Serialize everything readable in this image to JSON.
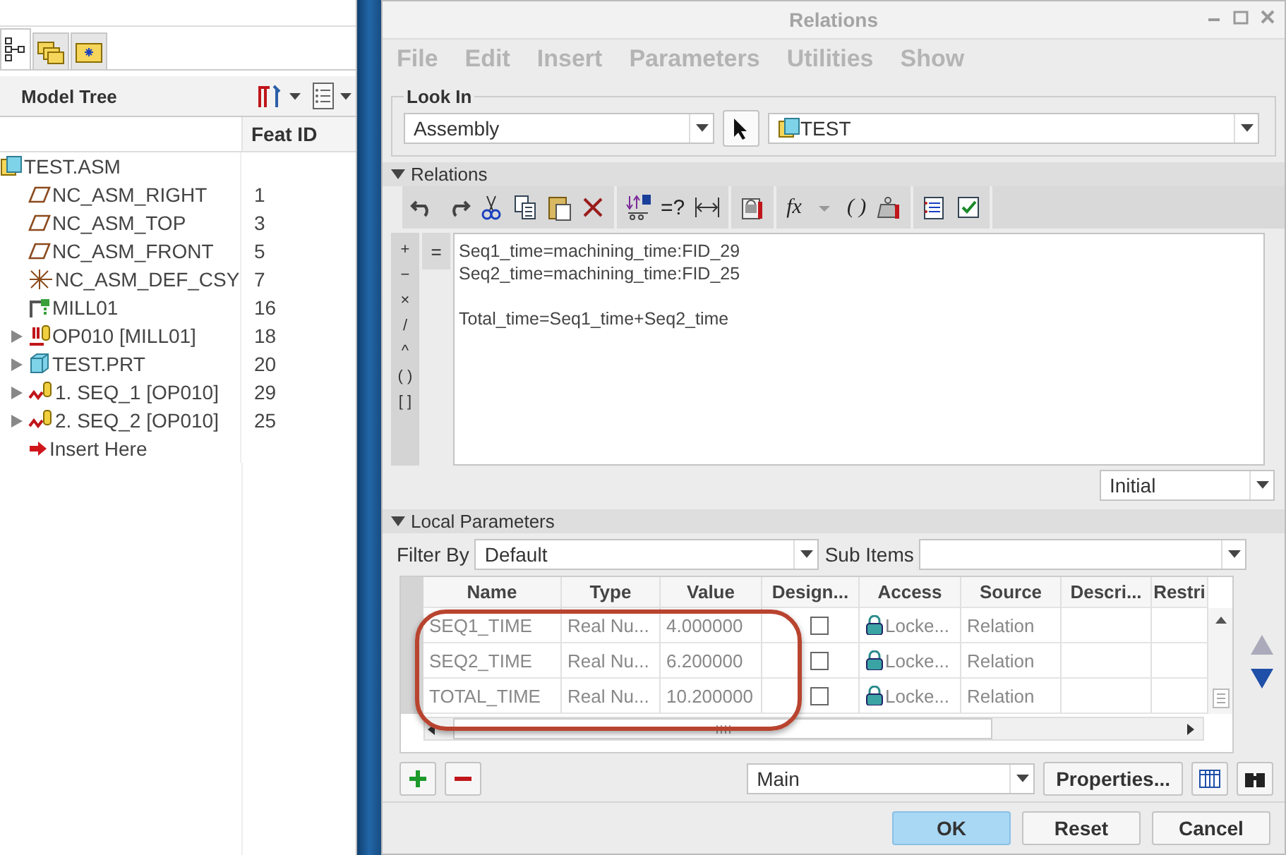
{
  "model_tree": {
    "tabs": [
      {
        "selected": true
      },
      {
        "selected": false
      },
      {
        "selected": false
      }
    ],
    "title": "Model Tree",
    "column": "Feat ID",
    "items": [
      {
        "label": "TEST.ASM",
        "kind": "assembly",
        "expandable": false,
        "children": [
          {
            "label": "NC_ASM_RIGHT",
            "feat_id": "1",
            "kind": "datum-plane",
            "expandable": false
          },
          {
            "label": "NC_ASM_TOP",
            "feat_id": "3",
            "kind": "datum-plane",
            "expandable": false
          },
          {
            "label": "NC_ASM_FRONT",
            "feat_id": "5",
            "kind": "datum-plane",
            "expandable": false
          },
          {
            "label": "NC_ASM_DEF_CSY",
            "feat_id": "7",
            "kind": "csys",
            "expandable": false
          },
          {
            "label": "MILL01",
            "feat_id": "16",
            "kind": "workcell",
            "expandable": false
          },
          {
            "label": "OP010 [MILL01]",
            "feat_id": "18",
            "kind": "operation",
            "expandable": true
          },
          {
            "label": "TEST.PRT",
            "feat_id": "20",
            "kind": "part",
            "expandable": true
          },
          {
            "label": "1. SEQ_1 [OP010]",
            "feat_id": "29",
            "kind": "sequence",
            "expandable": true
          },
          {
            "label": "2. SEQ_2 [OP010]",
            "feat_id": "25",
            "kind": "sequence",
            "expandable": true
          },
          {
            "label": "Insert Here",
            "kind": "insert",
            "expandable": false
          }
        ]
      }
    ]
  },
  "window": {
    "title": "Relations"
  },
  "menu": [
    {
      "label": "File",
      "disabled": true
    },
    {
      "label": "Edit",
      "disabled": true
    },
    {
      "label": "Insert",
      "disabled": true
    },
    {
      "label": "Parameters",
      "disabled": true
    },
    {
      "label": "Utilities",
      "disabled": true
    },
    {
      "label": "Show",
      "disabled": true
    }
  ],
  "look_in": {
    "label": "Look In",
    "type": "Assembly",
    "object": "TEST"
  },
  "relations": {
    "label": "Relations",
    "expanded": true,
    "toolbar": [
      {
        "kind": "undo"
      },
      {
        "kind": "redo"
      },
      {
        "kind": "cut"
      },
      {
        "kind": "copy"
      },
      {
        "kind": "paste"
      },
      {
        "kind": "delete"
      },
      {
        "kind": "separator"
      },
      {
        "kind": "param-value"
      },
      {
        "kind": "text",
        "text": "=?"
      },
      {
        "kind": "dimension"
      },
      {
        "kind": "separator"
      },
      {
        "kind": "lock-report"
      },
      {
        "kind": "separator"
      },
      {
        "kind": "text",
        "text": "fx"
      },
      {
        "kind": "dropdown"
      },
      {
        "kind": "text",
        "text": "( )"
      },
      {
        "kind": "weight"
      },
      {
        "kind": "separator"
      },
      {
        "kind": "list"
      },
      {
        "kind": "verify"
      }
    ],
    "operators": [
      "+",
      "−",
      "×",
      "/",
      "^",
      "( )",
      "[ ]"
    ],
    "equals": "=",
    "text": "Seq1_time=machining_time:FID_29\nSeq2_time=machining_time:FID_25\n\nTotal_time=Seq1_time+Seq2_time",
    "mode": "Initial"
  },
  "local_parameters": {
    "label": "Local Parameters",
    "expanded": true,
    "filter_label": "Filter By",
    "filter": "Default",
    "sub_items_label": "Sub Items",
    "columns": [
      "Name",
      "Type",
      "Value",
      "Design...",
      "Access",
      "Source",
      "Descri...",
      "Restri"
    ],
    "rows": [
      {
        "name": "SEQ1_TIME",
        "type": "Real Nu...",
        "value": "4.000000",
        "designate": false,
        "access": "Locke...",
        "source": "Relation"
      },
      {
        "name": "SEQ2_TIME",
        "type": "Real Nu...",
        "value": "6.200000",
        "designate": false,
        "access": "Locke...",
        "source": "Relation"
      },
      {
        "name": "TOTAL_TIME",
        "type": "Real Nu...",
        "value": "10.200000",
        "designate": false,
        "access": "Locke...",
        "source": "Relation"
      }
    ],
    "highlighted": true,
    "view": "Main",
    "properties": "Properties..."
  },
  "buttons": [
    {
      "label": "OK",
      "default": true
    },
    {
      "label": "Reset",
      "default": false
    },
    {
      "label": "Cancel",
      "default": false
    }
  ]
}
